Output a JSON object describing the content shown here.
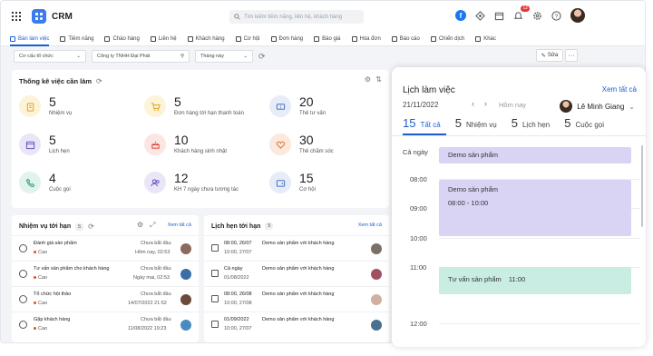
{
  "app": {
    "name": "CRM"
  },
  "search": {
    "placeholder": "Tìm kiếm tiềm năng, liên hệ, khách hàng"
  },
  "notifications": {
    "count": "12"
  },
  "nav": [
    "Bàn làm việc",
    "Tiềm năng",
    "Chào hàng",
    "Liên hệ",
    "Khách hàng",
    "Cơ hội",
    "Đơn hàng",
    "Báo giá",
    "Hóa đơn",
    "Báo cáo",
    "Chiến dịch",
    "Khác"
  ],
  "filters": {
    "org": "Cơ cấu tổ chức",
    "company": "Công ty TNHH Đại Phát",
    "period": "Tháng này"
  },
  "toolbar": {
    "edit_label": "Sửa",
    "more_label": "···"
  },
  "stats": {
    "title": "Thống kê việc cần làm",
    "items": [
      {
        "value": "5",
        "label": "Nhiệm vụ",
        "icon": "clipboard-icon",
        "color": "#fdf3d9"
      },
      {
        "value": "5",
        "label": "Đơn hàng tới hạn thanh toán",
        "icon": "cart-icon",
        "color": "#fdf3d9"
      },
      {
        "value": "20",
        "label": "Thẻ tư vấn",
        "icon": "ticket-icon",
        "color": "#e6ecf8"
      },
      {
        "value": "5",
        "label": "Lịch hẹn",
        "icon": "calendar-icon",
        "color": "#ebe6f7"
      },
      {
        "value": "10",
        "label": "Khách hàng sinh nhật",
        "icon": "cake-icon",
        "color": "#fbe6e3"
      },
      {
        "value": "30",
        "label": "Thẻ chăm sóc",
        "icon": "heart-icon",
        "color": "#fbe9dd"
      },
      {
        "value": "4",
        "label": "Cuộc gọi",
        "icon": "phone-icon",
        "color": "#e1f3ec"
      },
      {
        "value": "12",
        "label": "KH 7 ngày chưa tương tác",
        "icon": "users-icon",
        "color": "#ebe6f7"
      },
      {
        "value": "15",
        "label": "Cơ hội",
        "icon": "wallet-icon",
        "color": "#e6ecf8"
      }
    ]
  },
  "tasks": {
    "title": "Nhiệm vụ tới hạn",
    "count": "5",
    "see_all": "Xem tất cả",
    "rows": [
      {
        "name": "Đánh giá sản phẩm",
        "priority": "Cao",
        "status": "Chưa bắt đầu",
        "date": "Hôm nay, 02:53"
      },
      {
        "name": "Tư vấn sản phẩm cho khách hàng",
        "priority": "Cao",
        "status": "Chưa bắt đầu",
        "date": "Ngày mai, 02:53"
      },
      {
        "name": "Tổ chức hội thảo",
        "priority": "Cao",
        "status": "Chưa bắt đầu",
        "date": "14/07/2022 21:52"
      },
      {
        "name": "Gặp khách hàng",
        "priority": "Cao",
        "status": "Chưa bắt đầu",
        "date": "11/08/2022 19:23"
      }
    ]
  },
  "appointments": {
    "title": "Lịch hẹn tới hạn",
    "count": "5",
    "see_all": "Xem tất cả",
    "rows": [
      {
        "time": "08:00, 26/07",
        "end": "10:00, 27/07",
        "name": "Demo sản phẩm với khách hàng"
      },
      {
        "time": "Cả ngày",
        "end": "01/08/2022",
        "name": "Demo sản phẩm với khách hàng"
      },
      {
        "time": "08:00, 26/08",
        "end": "10:00, 27/08",
        "name": "Demo sản phẩm với khách hàng"
      },
      {
        "time": "01/09/2022",
        "end": "10:00, 27/07",
        "name": "Demo sản phẩm với khách hàng"
      }
    ]
  },
  "calendar": {
    "title": "Lịch làm việc",
    "see_all": "Xem tất cả",
    "date": "21/11/2022",
    "today": "Hôm nay",
    "user": "Lê Minh Giang",
    "tabs": [
      {
        "count": "15",
        "label": "Tất cả"
      },
      {
        "count": "5",
        "label": "Nhiệm vụ"
      },
      {
        "count": "5",
        "label": "Lịch hẹn"
      },
      {
        "count": "5",
        "label": "Cuộc gọi"
      }
    ],
    "allday_label": "Cả ngày",
    "hours": [
      "08:00",
      "09:00",
      "10:00",
      "11:00",
      "12:00"
    ],
    "events": [
      {
        "title": "Demo sản phẩm",
        "time": ""
      },
      {
        "title": "Demo sản phẩm",
        "time": "08:00 - 10:00"
      },
      {
        "title": "Tư vấn sản phẩm",
        "time": "11:00"
      }
    ]
  }
}
